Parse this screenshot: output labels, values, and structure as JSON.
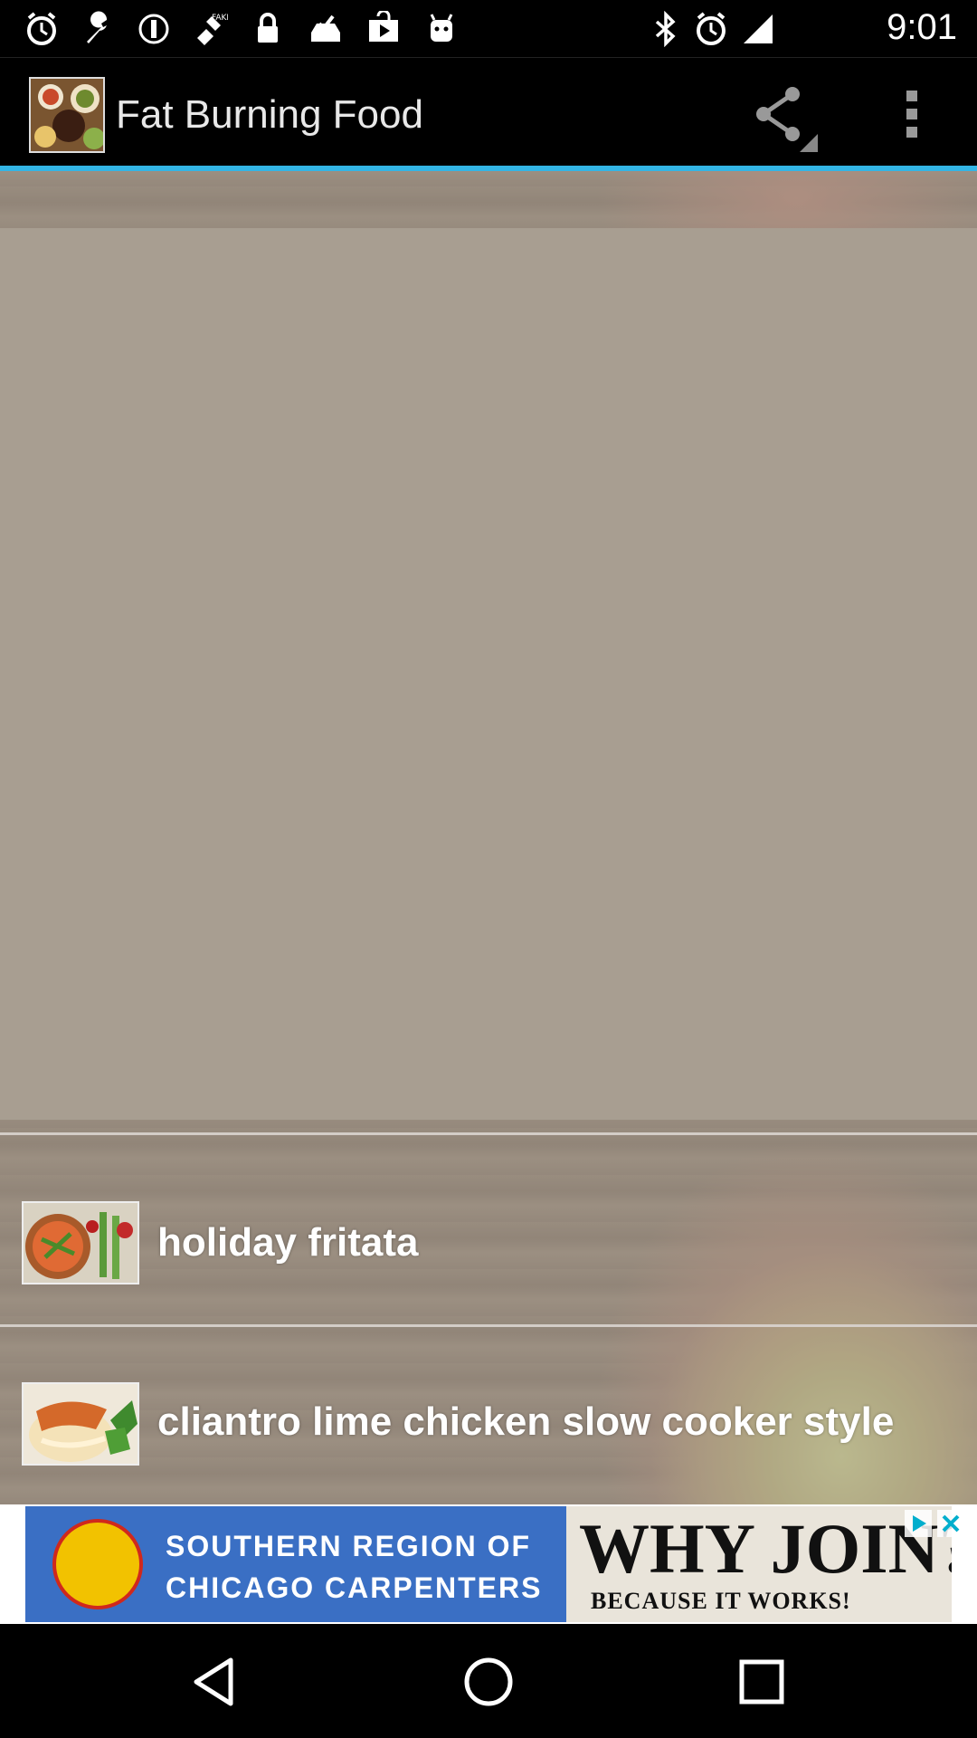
{
  "status_bar": {
    "time": "9:01",
    "left_icons": [
      "alarm-icon",
      "wrench-icon",
      "fake-gps-icon",
      "satellite-icon",
      "lock-icon",
      "inbox-check-icon",
      "play-store-icon",
      "android-icon"
    ],
    "right_icons": [
      "bluetooth-icon",
      "alarm-icon",
      "signal-icon"
    ]
  },
  "action_bar": {
    "title": "Fat Burning Food",
    "actions": [
      "share-icon",
      "overflow-menu-icon"
    ],
    "accent_color": "#33b5e5"
  },
  "list": {
    "items": [
      {
        "label": "holiday fritata",
        "icon": "fritata-thumbnail"
      },
      {
        "label": "cliantro lime chicken slow cooker style",
        "icon": "chicken-thumbnail"
      }
    ]
  },
  "ad": {
    "line1": "SOUTHERN REGION OF",
    "line2": "CHICAGO CARPENTERS",
    "headline": "WHY JOIN?",
    "subline": "BECAUSE IT WORKS!",
    "controls": [
      "ad-choices-icon",
      "close-icon"
    ]
  },
  "nav_bar": {
    "buttons": [
      "back-icon",
      "home-icon",
      "recents-icon"
    ]
  }
}
